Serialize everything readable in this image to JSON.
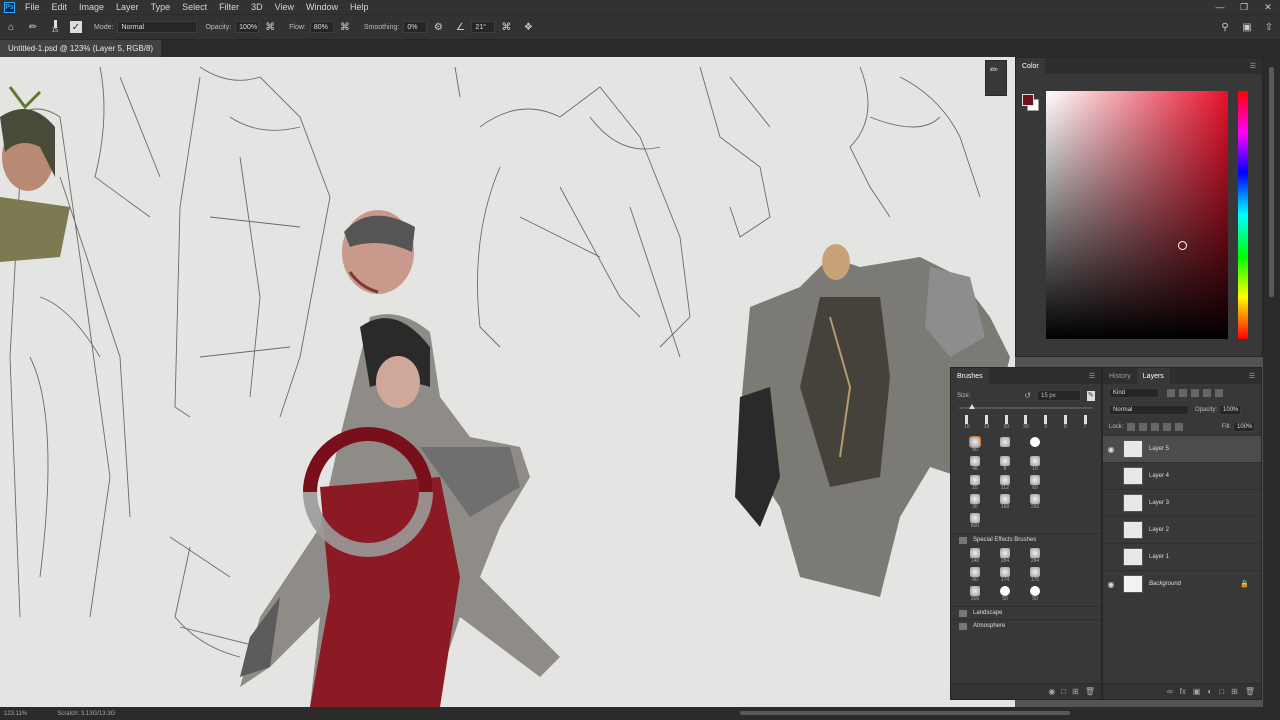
{
  "menubar": {
    "app_icon": "Ps",
    "items": [
      "File",
      "Edit",
      "Image",
      "Layer",
      "Type",
      "Select",
      "Filter",
      "3D",
      "View",
      "Window",
      "Help"
    ]
  },
  "options": {
    "mode_label": "Mode:",
    "mode_value": "Normal",
    "opacity_label": "Opacity:",
    "opacity_value": "100%",
    "flow_label": "Flow:",
    "flow_value": "80%",
    "smoothing_label": "Smoothing:",
    "smoothing_value": "0%",
    "angle_value": "21°",
    "brush_size": "15"
  },
  "document": {
    "tab_title": "Untitled-1.psd @ 123% (Layer 5, RGB/8)"
  },
  "status": {
    "zoom": "123.11%",
    "scratch": "Scratch: 3.13G/13.3G"
  },
  "color_panel": {
    "title": "Color",
    "foreground": "#6d1420",
    "background": "#ffffff"
  },
  "brushes_panel": {
    "tab": "Brushes",
    "size_label": "Size:",
    "size_value": "15 px",
    "presets": [
      "15",
      "10",
      "20",
      "30",
      "9",
      "8",
      "7"
    ],
    "grid_numbers": [
      "80",
      "",
      "",
      "",
      "45",
      "8",
      "10",
      "",
      "25",
      "112",
      "60",
      "",
      "30",
      "168",
      "250",
      "",
      "800"
    ],
    "groups": [
      "Special Effects Brushes",
      "Landscape",
      "Atmosphere"
    ],
    "special_numbers": [
      "140",
      "284",
      "284",
      "80",
      "174",
      "175",
      "306",
      "50",
      "50"
    ]
  },
  "layers_panel": {
    "tabs": [
      "History",
      "Layers"
    ],
    "kind_label": "Kind",
    "blend_mode": "Normal",
    "opacity_label": "Opacity:",
    "opacity_value": "100%",
    "lock_label": "Lock:",
    "fill_label": "Fill:",
    "fill_value": "100%",
    "layers": [
      "Layer 5",
      "Layer 4",
      "Layer 3",
      "Layer 2",
      "Layer 1",
      "Background"
    ]
  }
}
